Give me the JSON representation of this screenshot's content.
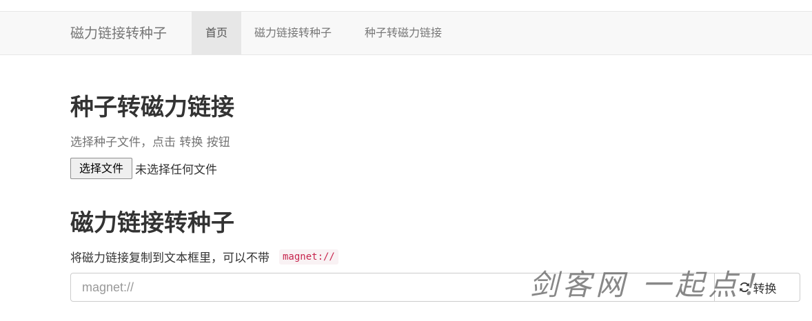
{
  "navbar": {
    "brand": "磁力链接转种子",
    "items": [
      {
        "label": "首页",
        "active": true
      },
      {
        "label": "磁力链接转种子",
        "active": false
      },
      {
        "label": "种子转磁力链接",
        "active": false
      }
    ]
  },
  "torrent_to_magnet": {
    "heading": "种子转磁力链接",
    "help_text": "选择种子文件，点击 转换 按钮",
    "file_button_label": "选择文件",
    "file_status": "未选择任何文件"
  },
  "magnet_to_torrent": {
    "heading": "磁力链接转种子",
    "description": "将磁力链接复制到文本框里，可以不带",
    "code_hint": "magnet://",
    "input_placeholder": "magnet://",
    "input_value": "",
    "convert_button_label": "转换",
    "convert_icon": "refresh-icon"
  },
  "watermark": {
    "text": "剑客网 一起点！"
  },
  "colors": {
    "navbar_bg": "#f8f8f8",
    "nav_active_bg": "#e7e7e7",
    "code_text": "#c7254e",
    "code_bg": "#f9f2f4"
  }
}
